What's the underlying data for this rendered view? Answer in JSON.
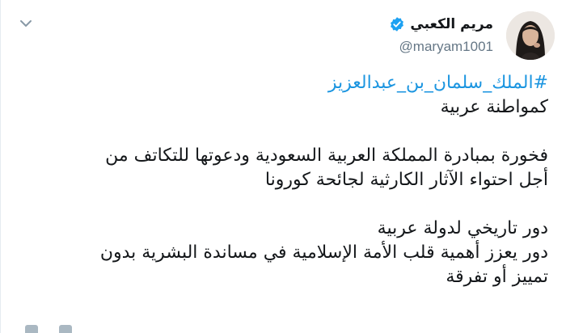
{
  "tweet": {
    "author": {
      "display_name": "مريم الكعبي",
      "handle": "@maryam1001",
      "verified": true
    },
    "hashtag": "#الملك_سلمان_بن_عبدالعزيز",
    "paragraphs": [
      [
        "كمواطنة عربية"
      ],
      [
        "فخورة بمبادرة المملكة العربية السعودية ودعوتها للتكاتف من",
        "أجل احتواء الآثار الكارثية لجائحة كورونا"
      ],
      [
        "دور تاريخي لدولة عربية",
        "دور يعزز أهمية قلب الأمة الإسلامية في مساندة البشرية بدون",
        "تمييز أو تفرقة"
      ]
    ]
  },
  "icons": {
    "menu": "chevron-down-icon",
    "verified": "verified-badge-icon"
  },
  "colors": {
    "link": "#1b95e0",
    "text": "#14171a",
    "muted": "#657786",
    "verified": "#1da1f2"
  }
}
